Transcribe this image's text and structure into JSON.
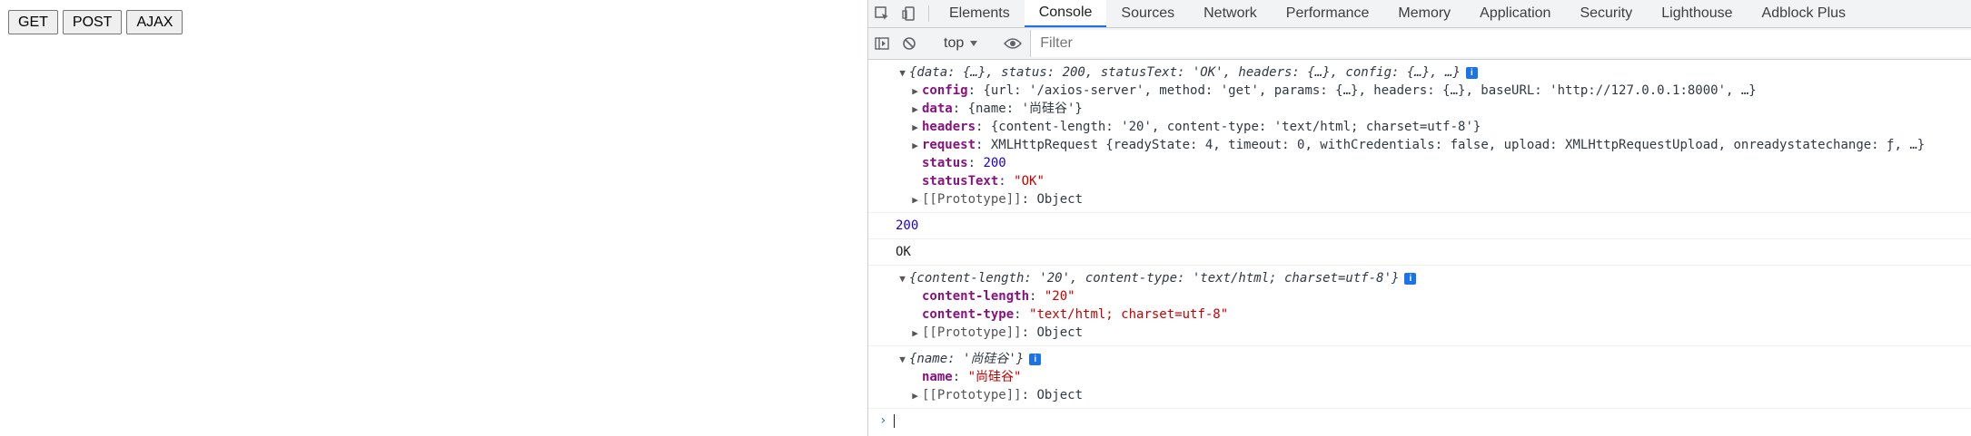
{
  "page": {
    "buttons": [
      "GET",
      "POST",
      "AJAX"
    ]
  },
  "devtools": {
    "tabs": [
      "Elements",
      "Console",
      "Sources",
      "Network",
      "Performance",
      "Memory",
      "Application",
      "Security",
      "Lighthouse",
      "Adblock Plus"
    ],
    "active_tab": "Console",
    "context": "top",
    "filter_placeholder": "Filter"
  },
  "console": {
    "response_summary": "{data: {…}, status: 200, statusText: 'OK', headers: {…}, config: {…}, …}",
    "config_key": "config",
    "config_val": "{url: '/axios-server', method: 'get', params: {…}, headers: {…}, baseURL: 'http://127.0.0.1:8000', …}",
    "data_key": "data",
    "data_val": "{name: '尚硅谷'}",
    "headers_key": "headers",
    "headers_val": "{content-length: '20', content-type: 'text/html; charset=utf-8'}",
    "request_key": "request",
    "request_val": "XMLHttpRequest {readyState: 4, timeout: 0, withCredentials: false, upload: XMLHttpRequestUpload, onreadystatechange: ƒ, …}",
    "status_key": "status",
    "status_val": "200",
    "statusText_key": "statusText",
    "statusText_val": "\"OK\"",
    "proto_label": "[[Prototype]]",
    "proto_val": "Object",
    "log_status": "200",
    "log_statusText": "OK",
    "headers_summary": "{content-length: '20', content-type: 'text/html; charset=utf-8'}",
    "cl_key": "content-length",
    "cl_val": "\"20\"",
    "ct_key": "content-type",
    "ct_val": "\"text/html; charset=utf-8\"",
    "name_summary": "{name: '尚硅谷'}",
    "name_key": "name",
    "name_val": "\"尚硅谷\"",
    "info_glyph": "i",
    "prompt_glyph": "›"
  }
}
